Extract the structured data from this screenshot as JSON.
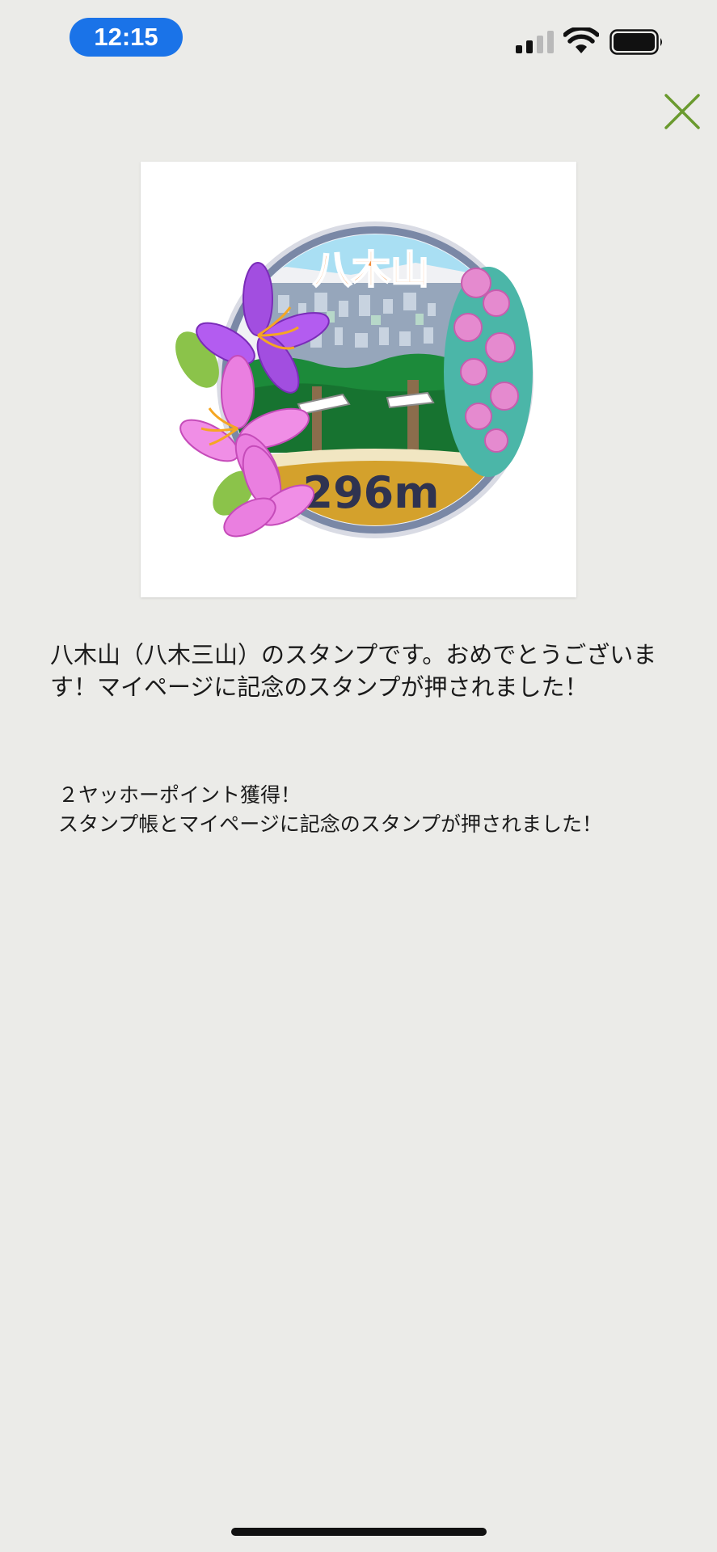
{
  "status_bar": {
    "time": "12:15"
  },
  "close": {
    "icon": "close-icon",
    "color": "#6a9a2e"
  },
  "stamp": {
    "mountain_name": "八木山",
    "elevation": "296m"
  },
  "message": {
    "body": "八木山（八木三山）のスタンプです。おめでとうございます！マイページに記念のスタンプが押されました！"
  },
  "reward": {
    "points_line": "２ヤッホーポイント獲得！",
    "stamp_line": "スタンプ帳とマイページに記念のスタンプが押されました！"
  }
}
